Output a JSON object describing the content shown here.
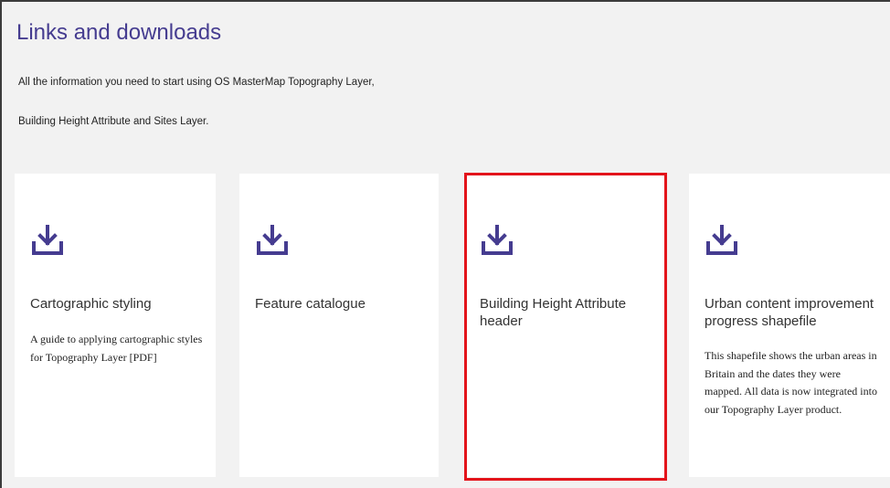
{
  "page": {
    "title": "Links and downloads",
    "intro_line1": "All the information you need to start using OS MasterMap Topography Layer,",
    "intro_line2": "Building Height Attribute and Sites Layer."
  },
  "colors": {
    "accent": "#453c90",
    "highlight": "#e3141b",
    "background": "#f2f2f2",
    "card": "#ffffff"
  },
  "cards": [
    {
      "icon": "download-icon",
      "title": "Cartographic styling",
      "description": "A guide to applying cartographic styles for Topography Layer [PDF]"
    },
    {
      "icon": "download-icon",
      "title": "Feature catalogue",
      "description": ""
    },
    {
      "icon": "download-icon",
      "title": "Building Height Attribute header",
      "description": ""
    },
    {
      "icon": "download-icon",
      "title": "Urban content improvement progress shapefile",
      "description": "This shapefile shows the urban areas in Britain and the dates they were mapped. All data is now integrated into our Topography Layer product."
    }
  ]
}
